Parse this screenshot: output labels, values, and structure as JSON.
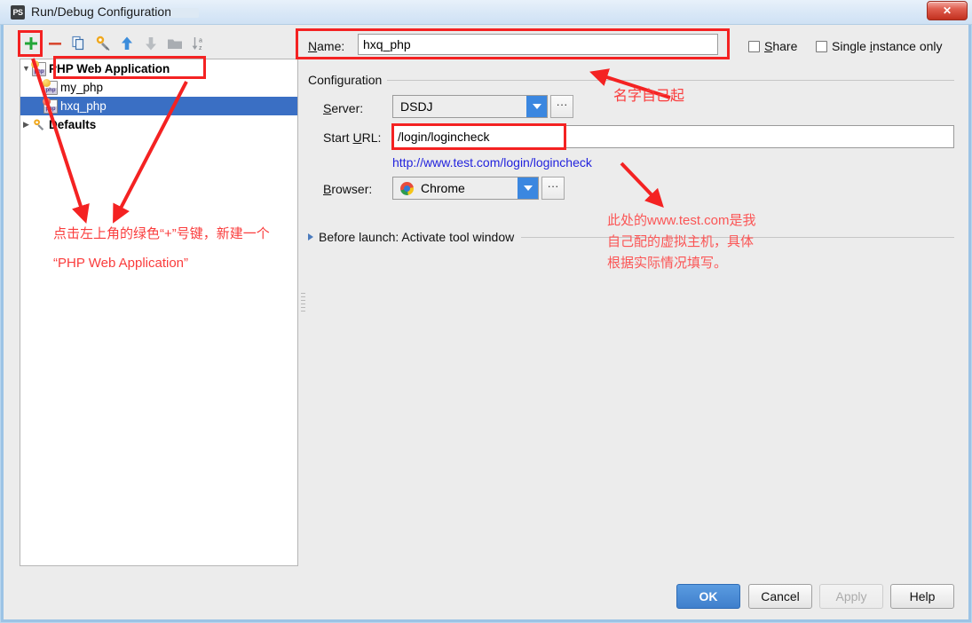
{
  "window": {
    "title": "Run/Debug Configurations",
    "app_icon": "PS",
    "close_label": "✕"
  },
  "toolbar": {
    "buttons": [
      {
        "name": "add-button",
        "icon": "plus-icon",
        "tooltip": "Add New Configuration"
      },
      {
        "name": "remove-button",
        "icon": "minus-icon",
        "tooltip": "Remove Configuration"
      },
      {
        "name": "copy-button",
        "icon": "copy-icon",
        "tooltip": "Copy Configuration"
      },
      {
        "name": "edit-defaults-button",
        "icon": "wrench-icon",
        "tooltip": "Edit defaults"
      },
      {
        "name": "move-up-button",
        "icon": "arrow-up-icon",
        "tooltip": "Move Up"
      },
      {
        "name": "move-down-button",
        "icon": "arrow-down-icon",
        "tooltip": "Move Down"
      },
      {
        "name": "new-folder-button",
        "icon": "folder-icon",
        "tooltip": "Create New Folder"
      },
      {
        "name": "sort-button",
        "icon": "sort-az-icon",
        "tooltip": "Sort Configurations"
      }
    ]
  },
  "tree": {
    "items": [
      {
        "label": "PHP Web Application",
        "icon": "php-config-icon",
        "level": 0,
        "expanded": true,
        "bold": true,
        "selected": false
      },
      {
        "label": "my_php",
        "icon": "php-config-icon",
        "level": 1,
        "expanded": null,
        "bold": false,
        "selected": false
      },
      {
        "label": "hxq_php",
        "icon": "php-config-icon-red",
        "level": 1,
        "expanded": null,
        "bold": false,
        "selected": true
      },
      {
        "label": "Defaults",
        "icon": "wrench-icon",
        "level": 0,
        "expanded": false,
        "bold": true,
        "selected": false
      }
    ]
  },
  "form": {
    "name_label": "Name:",
    "name_value": "hxq_php",
    "share": {
      "label": "Share",
      "checked": false
    },
    "single_instance": {
      "label": "Single instance only",
      "checked": false
    },
    "group_title": "Configuration",
    "server": {
      "label": "Server:",
      "value": "DSDJ",
      "ellipsis": "···"
    },
    "start_url": {
      "label": "Start URL:",
      "value": "/login/logincheck"
    },
    "url_preview": "http://www.test.com/login/logincheck",
    "browser": {
      "label": "Browser:",
      "value": "Chrome",
      "icon": "chrome-icon",
      "ellipsis": "···"
    },
    "before_launch": "Before launch: Activate tool window"
  },
  "footer": {
    "buttons": [
      {
        "label": "OK",
        "name": "ok-button",
        "state": "default"
      },
      {
        "label": "Cancel",
        "name": "cancel-button",
        "state": "normal"
      },
      {
        "label": "Apply",
        "name": "apply-button",
        "state": "disabled"
      },
      {
        "label": "Help",
        "name": "help-button",
        "state": "normal"
      }
    ]
  },
  "annotations": {
    "add_hint_line1": "点击左上角的绿色“+”号键，新建一个",
    "add_hint_line2": "“PHP Web Application”",
    "name_hint": "名字自己起",
    "host_hint_line1": "此处的www.test.com是我",
    "host_hint_line2": "自己配的虚拟主机，具体",
    "host_hint_line3": "根据实际情况填写。",
    "accent_color": "#fa3c3c"
  }
}
